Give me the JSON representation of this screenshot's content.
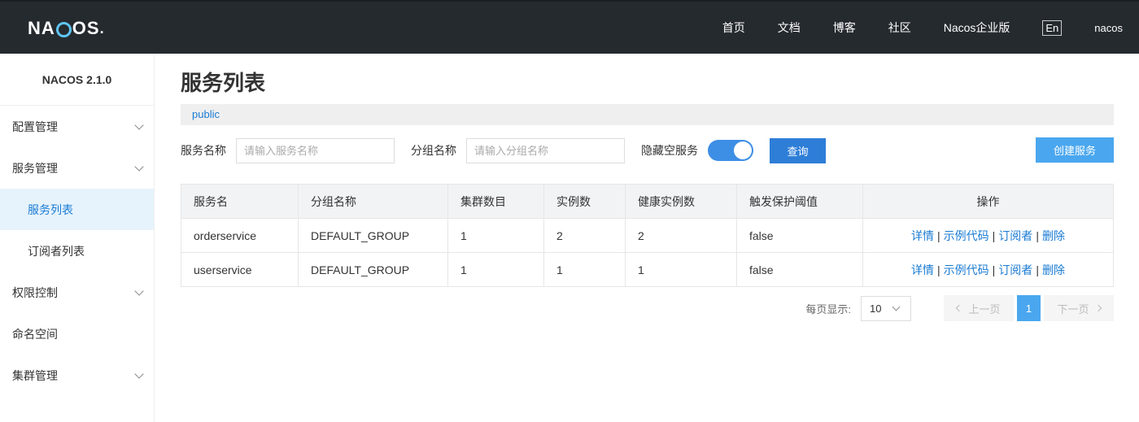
{
  "header": {
    "logo_pre": "NA",
    "logo_post": "OS",
    "logo_dot": ".",
    "nav": [
      "首页",
      "文档",
      "博客",
      "社区",
      "Nacos企业版"
    ],
    "lang": "En",
    "user": "nacos"
  },
  "sidebar": {
    "version": "NACOS 2.1.0",
    "items": [
      {
        "label": "配置管理"
      },
      {
        "label": "服务管理"
      },
      {
        "label": "服务列表"
      },
      {
        "label": "订阅者列表"
      },
      {
        "label": "权限控制"
      },
      {
        "label": "命名空间"
      },
      {
        "label": "集群管理"
      }
    ]
  },
  "main": {
    "title": "服务列表",
    "namespace": "public",
    "filters": {
      "service_label": "服务名称",
      "service_placeholder": "请输入服务名称",
      "group_label": "分组名称",
      "group_placeholder": "请输入分组名称",
      "hide_empty_label": "隐藏空服务",
      "hide_empty_on": true,
      "query_button": "查询",
      "create_button": "创建服务"
    },
    "table": {
      "columns": [
        "服务名",
        "分组名称",
        "集群数目",
        "实例数",
        "健康实例数",
        "触发保护阈值",
        "操作"
      ],
      "rows": [
        {
          "name": "orderservice",
          "group": "DEFAULT_GROUP",
          "clusters": "1",
          "instances": "2",
          "healthy": "2",
          "threshold": "false"
        },
        {
          "name": "userservice",
          "group": "DEFAULT_GROUP",
          "clusters": "1",
          "instances": "1",
          "healthy": "1",
          "threshold": "false"
        }
      ],
      "ops": {
        "detail": "详情",
        "sample": "示例代码",
        "subscriber": "订阅者",
        "delete": "删除",
        "separator": "|"
      }
    },
    "pager": {
      "per_page_label": "每页显示:",
      "page_size": "10",
      "prev": "上一页",
      "current": "1",
      "next": "下一页"
    }
  }
}
